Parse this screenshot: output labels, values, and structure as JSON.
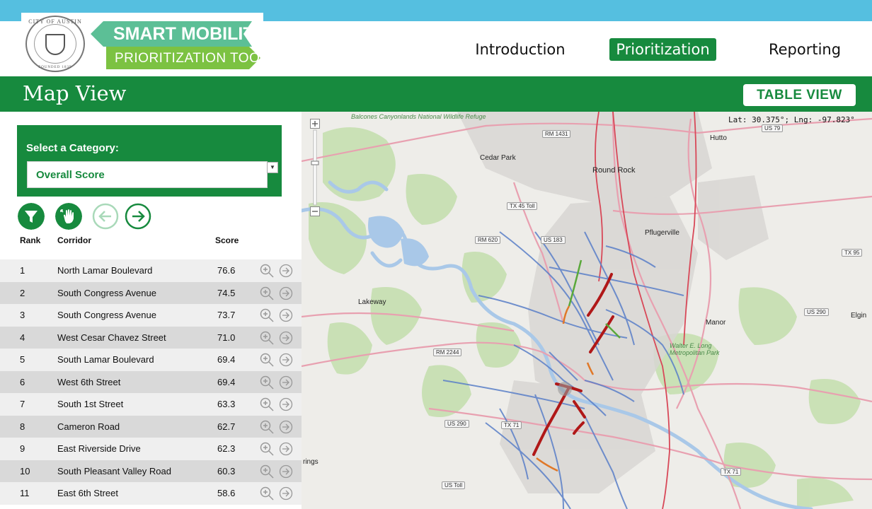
{
  "brand": {
    "seal_top": "CITY OF AUSTIN",
    "seal_bottom": "FOUNDED 1839",
    "title_line1": "SMART MOBILITY",
    "title_line2": "PRIORITIZATION TOOL",
    "title_line1_color": "#5cbf96",
    "title_line2_color": "#7cc242"
  },
  "nav": {
    "items": [
      {
        "label": "Introduction",
        "active": false
      },
      {
        "label": "Prioritization",
        "active": true
      },
      {
        "label": "Reporting",
        "active": false
      }
    ]
  },
  "page": {
    "title": "Map View",
    "table_view_button": "TABLE VIEW"
  },
  "category": {
    "label": "Select a Category:",
    "selected": "Overall Score"
  },
  "toolbar": {
    "filter_icon": "filter-icon",
    "pan_icon": "hand-pan-icon",
    "prev_icon": "arrow-left-icon",
    "next_icon": "arrow-right-icon"
  },
  "table": {
    "headers": {
      "rank": "Rank",
      "corridor": "Corridor",
      "score": "Score"
    },
    "rows": [
      {
        "rank": "1",
        "corridor": "North Lamar Boulevard",
        "score": "76.6"
      },
      {
        "rank": "2",
        "corridor": "South Congress Avenue",
        "score": "74.5"
      },
      {
        "rank": "3",
        "corridor": "South Congress Avenue",
        "score": "73.7"
      },
      {
        "rank": "4",
        "corridor": "West Cesar Chavez Street",
        "score": "71.0"
      },
      {
        "rank": "5",
        "corridor": "South Lamar Boulevard",
        "score": "69.4"
      },
      {
        "rank": "6",
        "corridor": "West 6th Street",
        "score": "69.4"
      },
      {
        "rank": "7",
        "corridor": "South 1st Street",
        "score": "63.3"
      },
      {
        "rank": "8",
        "corridor": "Cameron Road",
        "score": "62.7"
      },
      {
        "rank": "9",
        "corridor": "East Riverside Drive",
        "score": "62.3"
      },
      {
        "rank": "10",
        "corridor": "South Pleasant Valley Road",
        "score": "60.3"
      },
      {
        "rank": "11",
        "corridor": "East 6th Street",
        "score": "58.6"
      }
    ]
  },
  "map": {
    "coordinates": "Lat: 30.375°; Lng: -97.823°",
    "labels": {
      "balcones": "Balcones Canyonlands National Wildlife Refuge",
      "cedar_park": "Cedar Park",
      "round_rock": "Round Rock",
      "hutto": "Hutto",
      "pflugerville": "Pflugerville",
      "lakeway": "Lakeway",
      "manor": "Manor",
      "elgin": "Elgin",
      "metropolitan_park": "Walter E. Long Metropolitan Park",
      "rm1431": "RM 1431",
      "us79": "US 79",
      "tx45": "TX 45 Toll",
      "rm620": "RM 620",
      "us183": "US 183",
      "rm2244": "RM 2244",
      "us290_w": "US 290",
      "us290_e": "US 290",
      "tx95": "TX 95",
      "tx71_w": "TX 71",
      "tx71_e": "TX 71",
      "us_toll": "US Toll",
      "springs": "rings"
    }
  },
  "colors": {
    "brand_green": "#178a3e",
    "top_bar_blue": "#55bfe0",
    "row_light": "#efefef",
    "row_dark": "#d9d9d9"
  }
}
